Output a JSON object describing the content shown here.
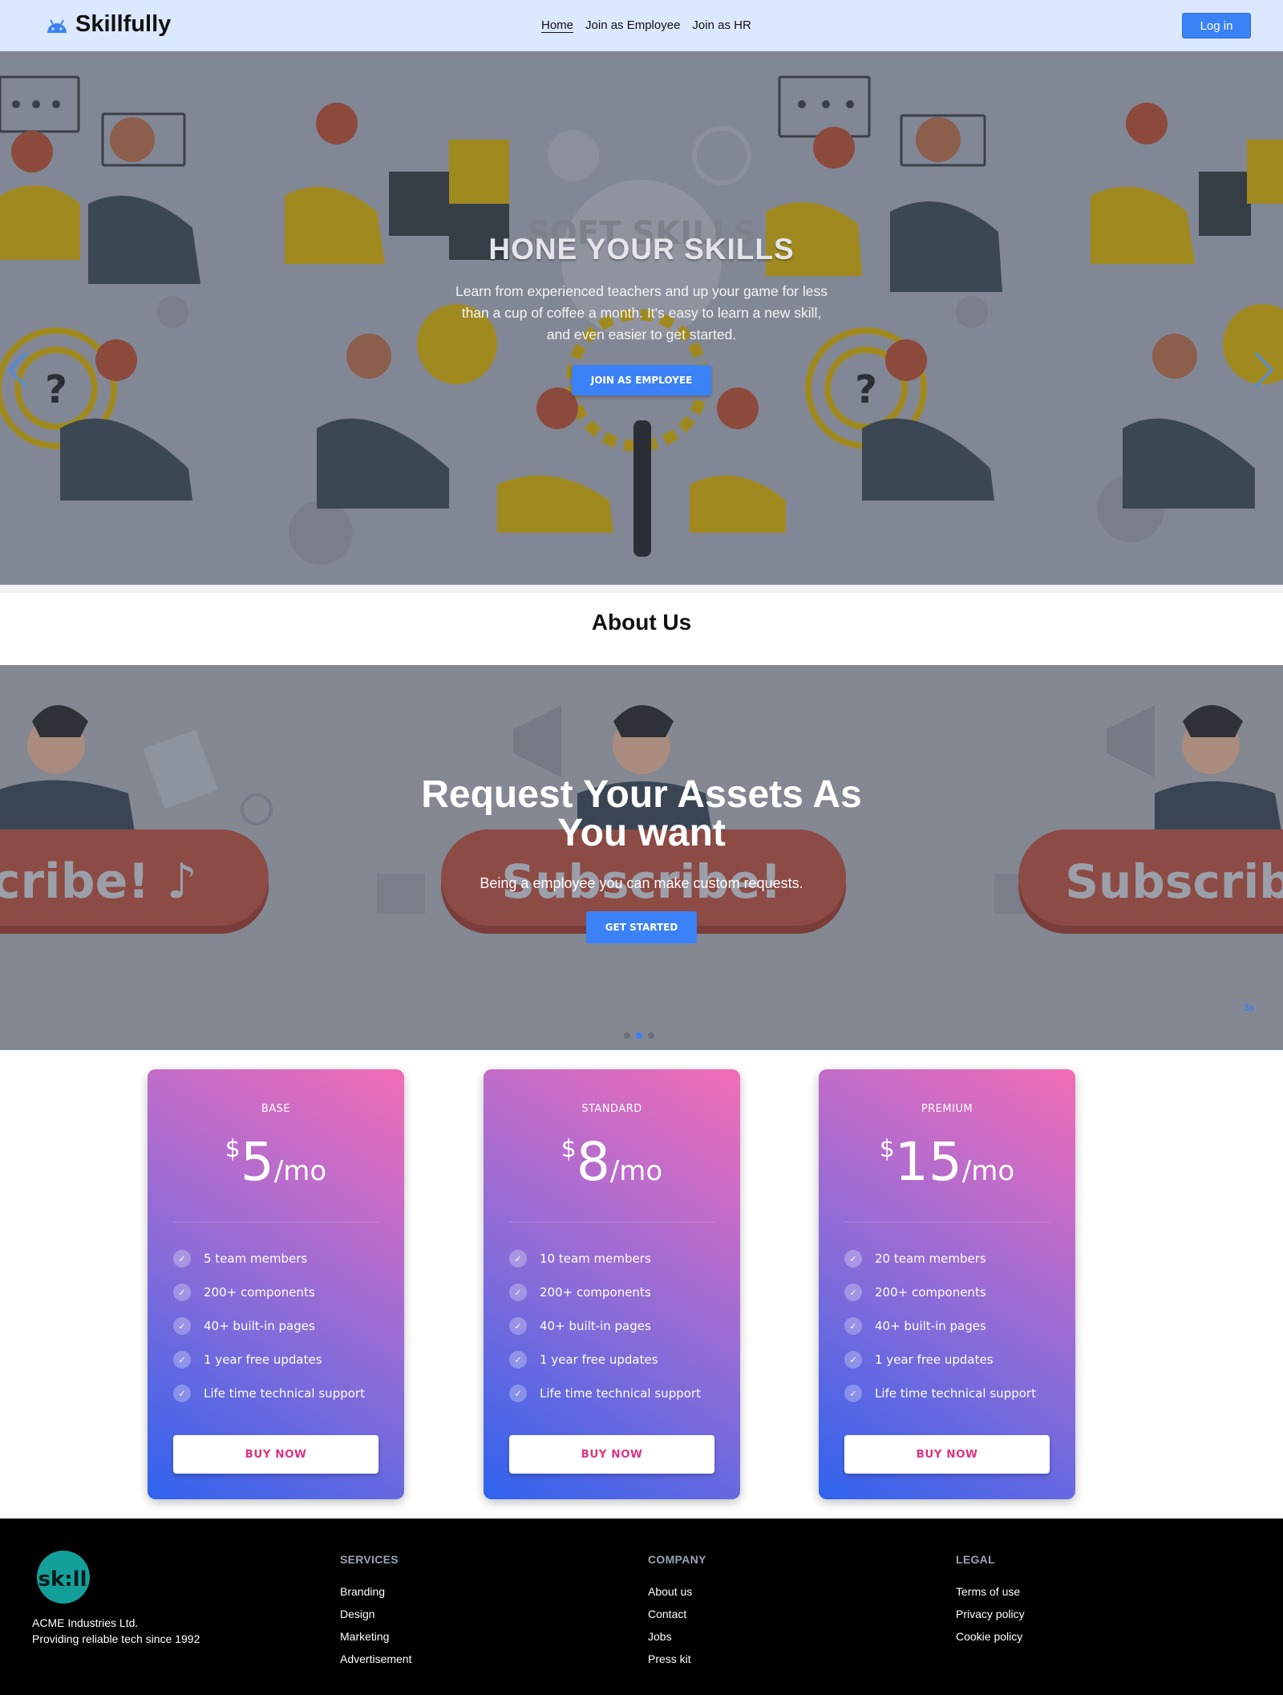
{
  "nav": {
    "brand": "Skillfully",
    "links": [
      "Home",
      "Join as Employee",
      "Join as HR"
    ],
    "login_label": "Log in"
  },
  "hero": {
    "title": "HONE YOUR SKILLS",
    "text": "Learn from experienced teachers and up your game for less than a cup of coffee a month. It's easy to learn a new skill, and even easier to get started.",
    "button_label": "JOIN AS EMPLOYEE",
    "illustration_text": "SOFT SKILLS"
  },
  "about": {
    "title": "About Us"
  },
  "carousel2": {
    "title": "Request Your Assets As You want",
    "text": "Being a employee you can make custom requests.",
    "button_label": "GET STARTED",
    "illustration_text": "Subscribe!",
    "slides_count": 3,
    "active_slide": 2,
    "timer": "3s"
  },
  "pricing": {
    "plans": [
      {
        "name": "BASE",
        "currency": "$",
        "amount": "5",
        "period": "/mo",
        "features": [
          "5 team members",
          "200+ components",
          "40+ built-in pages",
          "1 year free updates",
          "Life time technical support"
        ],
        "button_label": "BUY NOW"
      },
      {
        "name": "STANDARD",
        "currency": "$",
        "amount": "8",
        "period": "/mo",
        "features": [
          "10 team members",
          "200+ components",
          "40+ built-in pages",
          "1 year free updates",
          "Life time technical support"
        ],
        "button_label": "BUY NOW"
      },
      {
        "name": "PREMIUM",
        "currency": "$",
        "amount": "15",
        "period": "/mo",
        "features": [
          "20 team members",
          "200+ components",
          "40+ built-in pages",
          "1 year free updates",
          "Life time technical support"
        ],
        "button_label": "BUY NOW"
      }
    ]
  },
  "footer": {
    "logo_text": "sk:ll",
    "company_name": "ACME Industries Ltd.",
    "tagline": "Providing reliable tech since 1992",
    "columns": [
      {
        "title": "SERVICES",
        "links": [
          "Branding",
          "Design",
          "Marketing",
          "Advertisement"
        ]
      },
      {
        "title": "COMPANY",
        "links": [
          "About us",
          "Contact",
          "Jobs",
          "Press kit"
        ]
      },
      {
        "title": "LEGAL",
        "links": [
          "Terms of use",
          "Privacy policy",
          "Cookie policy"
        ]
      }
    ]
  },
  "colors": {
    "accent": "#3b82f6",
    "navbar_bg": "#dbe8fd",
    "card_gradient_start": "#2f63ee",
    "card_gradient_end": "#f26db5",
    "buy_text": "#e0347f"
  }
}
